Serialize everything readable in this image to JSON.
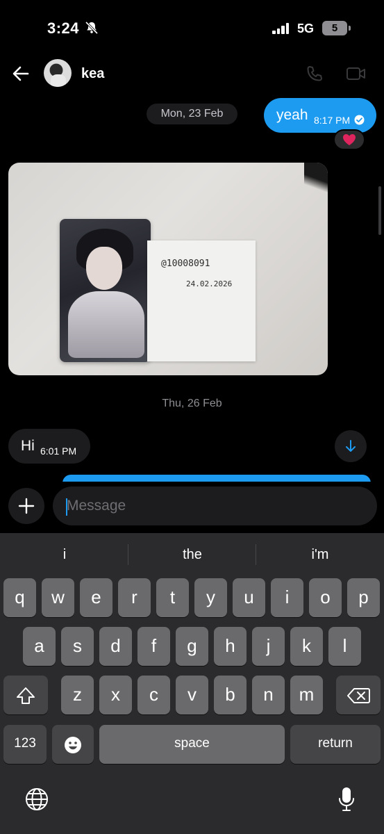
{
  "status_bar": {
    "time": "3:24",
    "network": "5G",
    "battery": "5"
  },
  "header": {
    "contact_name": "kea"
  },
  "chat": {
    "date_1": "Mon, 23 Feb",
    "outgoing": {
      "text": "yeah",
      "time": "8:17 PM",
      "reaction": "heart"
    },
    "photo_note": {
      "handle": "@10008091",
      "date": "24.02.2026"
    },
    "date_2": "Thu, 26 Feb",
    "incoming": {
      "text": "Hi",
      "time": "6:01 PM"
    }
  },
  "composer": {
    "placeholder": "Message"
  },
  "keyboard": {
    "suggestions": [
      "i",
      "the",
      "i'm"
    ],
    "row1": [
      "q",
      "w",
      "e",
      "r",
      "t",
      "y",
      "u",
      "i",
      "o",
      "p"
    ],
    "row2": [
      "a",
      "s",
      "d",
      "f",
      "g",
      "h",
      "j",
      "k",
      "l"
    ],
    "row3": [
      "z",
      "x",
      "c",
      "v",
      "b",
      "n",
      "m"
    ],
    "numbers_label": "123",
    "space_label": "space",
    "return_label": "return"
  },
  "colors": {
    "accent": "#1d9bf0",
    "bubble_in": "#1c1c1e",
    "keyboard_bg": "#2b2b2d"
  }
}
